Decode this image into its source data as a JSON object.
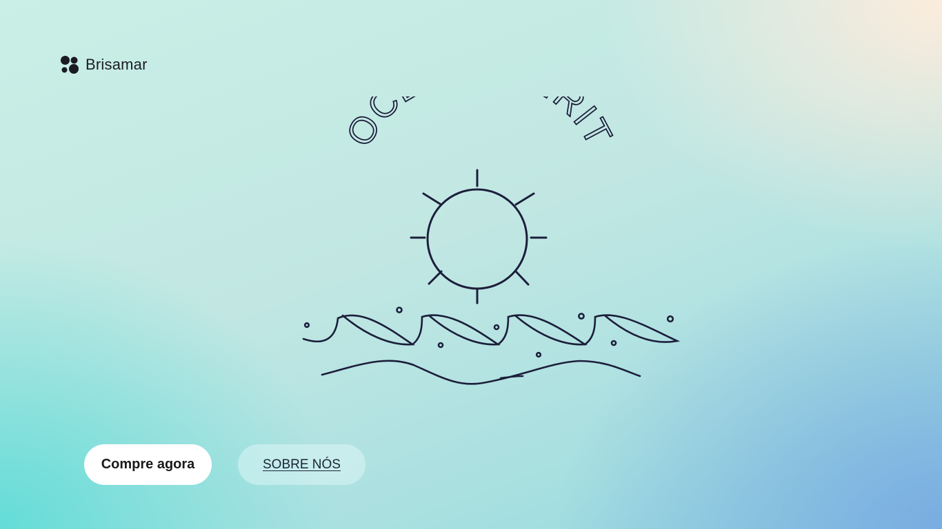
{
  "header": {
    "brand_name": "Brisamar",
    "brand_icon": "brisamar-logo-icon"
  },
  "hero": {
    "logo_title": "OCEAN SPIRIT",
    "logo_icons": [
      "sun-icon",
      "waves-icon"
    ]
  },
  "actions": {
    "primary_label": "Compre agora",
    "secondary_label": "SOBRE NÓS"
  },
  "colors": {
    "ink": "#1b1e3a",
    "button_primary_bg": "#ffffff",
    "button_secondary_bg": "#d6f1f1",
    "gradient_top_left": "#c9efe6",
    "gradient_top_right": "#ffece0",
    "gradient_bottom_left": "#5fdcd7",
    "gradient_bottom_right": "#7fb0e0"
  }
}
